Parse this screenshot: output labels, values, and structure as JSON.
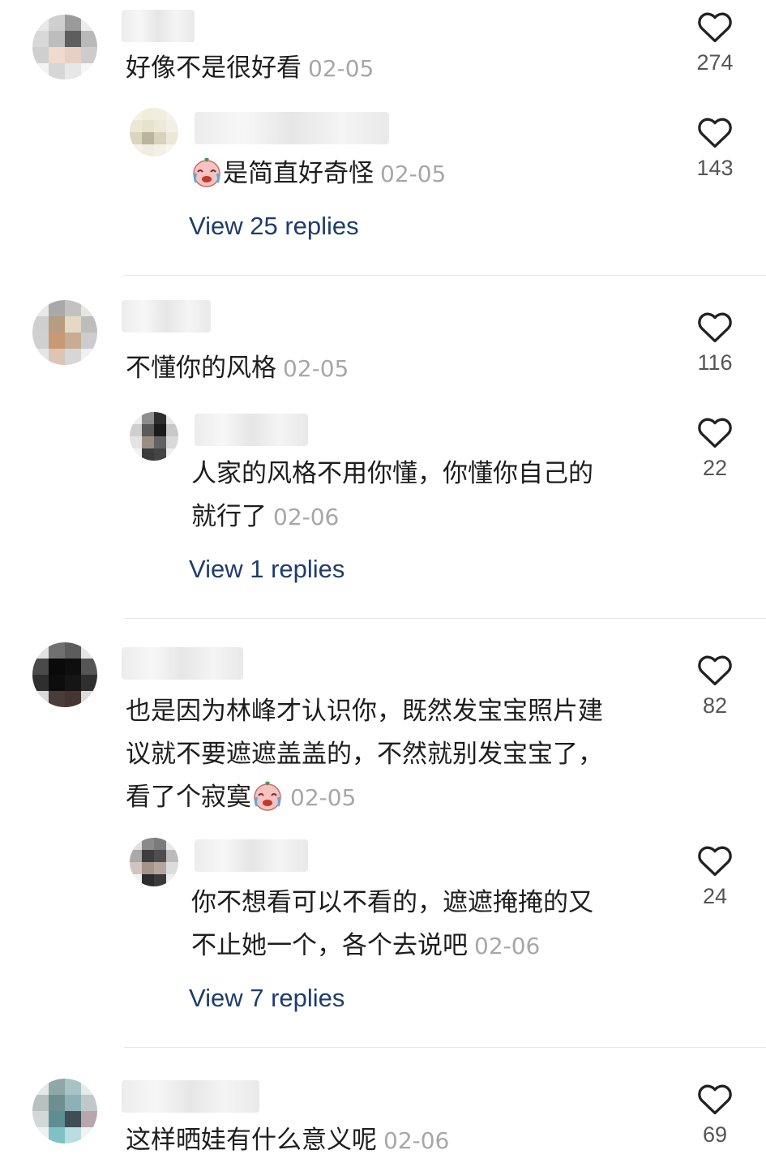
{
  "comments": [
    {
      "text": "好像不是很好看",
      "date": "02-05",
      "likes": "274",
      "reply": {
        "text": "是简直好奇怪",
        "date": "02-05",
        "likes": "143",
        "emoji": "crying-laughing-face"
      },
      "view_replies": "View 25 replies"
    },
    {
      "text": "不懂你的风格",
      "date": "02-05",
      "likes": "116",
      "reply": {
        "line1": "人家的风格不用你懂，你懂你自己的",
        "line2": "就行了",
        "date": "02-06",
        "likes": "22"
      },
      "view_replies": "View 1 replies"
    },
    {
      "line1": "也是因为林峰才认识你，既然发宝宝照片建",
      "line2": "议就不要遮遮盖盖的，不然就别发宝宝了，",
      "line3": "看了个寂寞",
      "date": "02-05",
      "likes": "82",
      "emoji": "crying-laughing-face",
      "reply": {
        "line1": "你不想看可以不看的，遮遮掩掩的又",
        "line2": "不止她一个，各个去说吧",
        "date": "02-06",
        "likes": "24"
      },
      "view_replies": "View 7 replies"
    },
    {
      "text": "这样晒娃有什么意义呢",
      "date": "02-06",
      "likes": "69"
    }
  ],
  "colors": {
    "link": "#1e3d6b",
    "date": "#a7a7a7",
    "text": "#1d1d1d",
    "count": "#555555"
  },
  "icons": {
    "like": "heart-outline-icon"
  }
}
